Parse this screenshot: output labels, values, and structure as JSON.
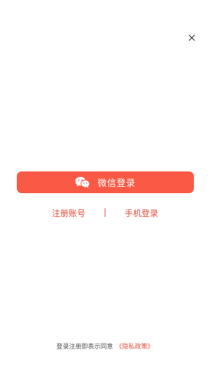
{
  "colors": {
    "accent": "#fa5a45",
    "accent_text": "#e2503d",
    "close_icon": "#333333"
  },
  "close": {
    "icon": "close-icon"
  },
  "wechat_login": {
    "label": "微信登录",
    "icon": "wechat-icon"
  },
  "alt_links": {
    "register": "注册账号",
    "separator": "|",
    "phone_login": "手机登录"
  },
  "agreement": {
    "text": "登录注册即表示同意",
    "policy_link": "《隐私政策》"
  }
}
